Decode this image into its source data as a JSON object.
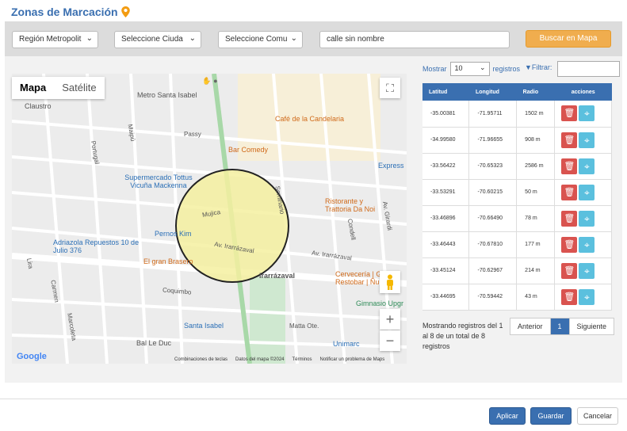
{
  "page": {
    "title": "Zonas de Marcación"
  },
  "filters": {
    "region": "Región Metropolit",
    "city": "Seleccione Ciuda",
    "commune": "Seleccione Comu",
    "address_value": "calle sin nombre",
    "search_button": "Buscar en Mapa"
  },
  "map": {
    "tab_map": "Mapa",
    "tab_satellite": "Satélite",
    "zoom_in": "+",
    "zoom_out": "−",
    "logo": "Google",
    "footer": [
      "Combinaciones de teclas",
      "Datos del mapa ©2024",
      "Términos",
      "Notificar un problema de Maps"
    ],
    "pois": [
      {
        "label": "Metro Santa Isabel",
        "kind": "g"
      },
      {
        "label": "Café de la Candelaria",
        "kind": "o"
      },
      {
        "label": "Bar Comedy",
        "kind": "o"
      },
      {
        "label": "Supermercado Tottus Vicuña Mackenna",
        "kind": "b"
      },
      {
        "label": "Ristorante y Trattoria Da Noi",
        "kind": "o"
      },
      {
        "label": "Adriazola Repuestos 10 de Julio 376",
        "kind": "b"
      },
      {
        "label": "Pernos Kim",
        "kind": "b"
      },
      {
        "label": "El gran Brasero",
        "kind": "o"
      },
      {
        "label": "Irarrázaval",
        "kind": "g"
      },
      {
        "label": "Cervecería | Glück Restobar | Ñuñoa",
        "kind": "o"
      },
      {
        "label": "Gimnasio Upgr",
        "kind": "gr"
      },
      {
        "label": "Santa Isabel",
        "kind": "b"
      },
      {
        "label": "Bal Le Duc",
        "kind": "g"
      },
      {
        "label": "Unimarc",
        "kind": "b"
      },
      {
        "label": "Express",
        "kind": "b"
      },
      {
        "label": "Claustro",
        "kind": "g"
      }
    ],
    "streets": [
      "Passy",
      "Mujica",
      "Av. Irarrázaval",
      "Av. Irarrázaval",
      "Coquimbo",
      "Matta Ote.",
      "Condell",
      "Seminario",
      "Portugal",
      "Maipú",
      "Lira",
      "Carmen",
      "Marcoleta",
      "Av. Girardi"
    ]
  },
  "table_controls": {
    "show_label": "Mostrar",
    "page_size": "10",
    "records_label": "registros",
    "filter_label": "Filtrar:"
  },
  "table": {
    "columns": [
      "Latitud",
      "Longitud",
      "Radio",
      "acciones"
    ],
    "rows": [
      [
        "-35.00381",
        "-71.95711",
        "1502 m"
      ],
      [
        "-34.99580",
        "-71.96655",
        "908 m"
      ],
      [
        "-33.56422",
        "-70.65323",
        "2586 m"
      ],
      [
        "-33.53291",
        "-70.60215",
        "50 m"
      ],
      [
        "-33.46896",
        "-70.66490",
        "78 m"
      ],
      [
        "-33.46443",
        "-70.67810",
        "177 m"
      ],
      [
        "-33.45124",
        "-70.62967",
        "214 m"
      ],
      [
        "-33.44695",
        "-70.59442",
        "43 m"
      ]
    ]
  },
  "pagination": {
    "info": "Mostrando registros del 1 al 8 de un total de 8 registros",
    "prev": "Anterior",
    "current": "1",
    "next": "Siguiente"
  },
  "footer": {
    "apply": "Aplicar",
    "save": "Guardar",
    "cancel": "Cancelar"
  },
  "colors": {
    "accent": "#3a6fb0",
    "warning": "#f0ad4e",
    "danger": "#d9534f",
    "info": "#5bc0de",
    "zone_fill": "#f5f0a0"
  }
}
